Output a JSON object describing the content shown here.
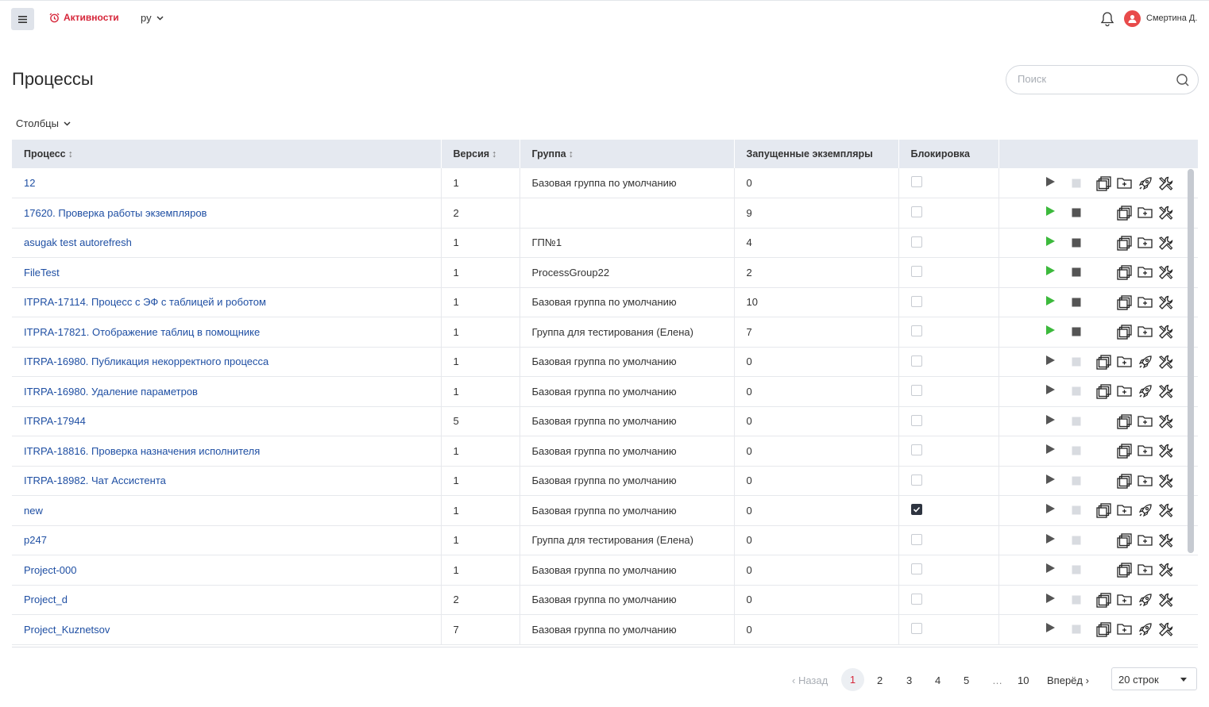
{
  "header": {
    "menu_icon": "hamburger-icon",
    "activities_label": "Активности",
    "language": "ру",
    "user_name": "Смертина Д."
  },
  "page": {
    "title": "Процессы",
    "search_placeholder": "Поиск",
    "columns_label": "Столбцы"
  },
  "table": {
    "headers": {
      "process": "Процесс",
      "version": "Версия",
      "group": "Группа",
      "instances": "Запущенные экземпляры",
      "blocking": "Блокировка"
    },
    "rows": [
      {
        "process": "12",
        "version": "1",
        "group": "Базовая группа по умолчанию",
        "instances": "0",
        "blocked": false,
        "running": false,
        "copy": true,
        "publish": true
      },
      {
        "process": "17620. Проверка работы экземпляров",
        "version": "2",
        "group": "",
        "instances": "9",
        "blocked": false,
        "running": true,
        "copy": false,
        "publish": false
      },
      {
        "process": "asugak test autorefresh",
        "version": "1",
        "group": "ГП№1",
        "instances": "4",
        "blocked": false,
        "running": true,
        "copy": false,
        "publish": false
      },
      {
        "process": "FileTest",
        "version": "1",
        "group": "ProcessGroup22",
        "instances": "2",
        "blocked": false,
        "running": true,
        "copy": false,
        "publish": false
      },
      {
        "process": "ITPRA-17114. Процесс с ЭФ с таблицей и роботом",
        "version": "1",
        "group": "Базовая группа по умолчанию",
        "instances": "10",
        "blocked": false,
        "running": true,
        "copy": false,
        "publish": false
      },
      {
        "process": "ITPRA-17821. Отображение таблиц в помощнике",
        "version": "1",
        "group": "Группа для тестирования (Елена)",
        "instances": "7",
        "blocked": false,
        "running": true,
        "copy": false,
        "publish": false
      },
      {
        "process": "ITRPA-16980. Публикация некорректного процесса",
        "version": "1",
        "group": "Базовая группа по умолчанию",
        "instances": "0",
        "blocked": false,
        "running": false,
        "copy": true,
        "publish": true
      },
      {
        "process": "ITRPA-16980. Удаление параметров",
        "version": "1",
        "group": "Базовая группа по умолчанию",
        "instances": "0",
        "blocked": false,
        "running": false,
        "copy": true,
        "publish": true
      },
      {
        "process": "ITRPA-17944",
        "version": "5",
        "group": "Базовая группа по умолчанию",
        "instances": "0",
        "blocked": false,
        "running": false,
        "copy": false,
        "publish": false
      },
      {
        "process": "ITRPA-18816. Проверка назначения исполнителя",
        "version": "1",
        "group": "Базовая группа по умолчанию",
        "instances": "0",
        "blocked": false,
        "running": false,
        "copy": false,
        "publish": false
      },
      {
        "process": "ITRPA-18982. Чат Ассистента",
        "version": "1",
        "group": "Базовая группа по умолчанию",
        "instances": "0",
        "blocked": false,
        "running": false,
        "copy": false,
        "publish": false
      },
      {
        "process": "new",
        "version": "1",
        "group": "Базовая группа по умолчанию",
        "instances": "0",
        "blocked": true,
        "running": false,
        "copy": true,
        "publish": true
      },
      {
        "process": "p247",
        "version": "1",
        "group": "Группа для тестирования (Елена)",
        "instances": "0",
        "blocked": false,
        "running": false,
        "copy": false,
        "publish": false
      },
      {
        "process": "Project-000",
        "version": "1",
        "group": "Базовая группа по умолчанию",
        "instances": "0",
        "blocked": false,
        "running": false,
        "copy": false,
        "publish": false
      },
      {
        "process": "Project_d",
        "version": "2",
        "group": "Базовая группа по умолчанию",
        "instances": "0",
        "blocked": false,
        "running": false,
        "copy": true,
        "publish": true
      },
      {
        "process": "Project_Kuznetsov",
        "version": "7",
        "group": "Базовая группа по умолчанию",
        "instances": "0",
        "blocked": false,
        "running": false,
        "copy": true,
        "publish": true
      }
    ]
  },
  "pagination": {
    "prev_label": "Назад",
    "pages": [
      "1",
      "2",
      "3",
      "4",
      "5",
      "…",
      "10"
    ],
    "current": "1",
    "next_label": "Вперёд",
    "rows_per_page": "20 строк"
  },
  "colors": {
    "accent": "#d6263a",
    "link": "#1f4fa3",
    "play_active": "#3cb93c",
    "header_bg": "#e5e9f0"
  }
}
